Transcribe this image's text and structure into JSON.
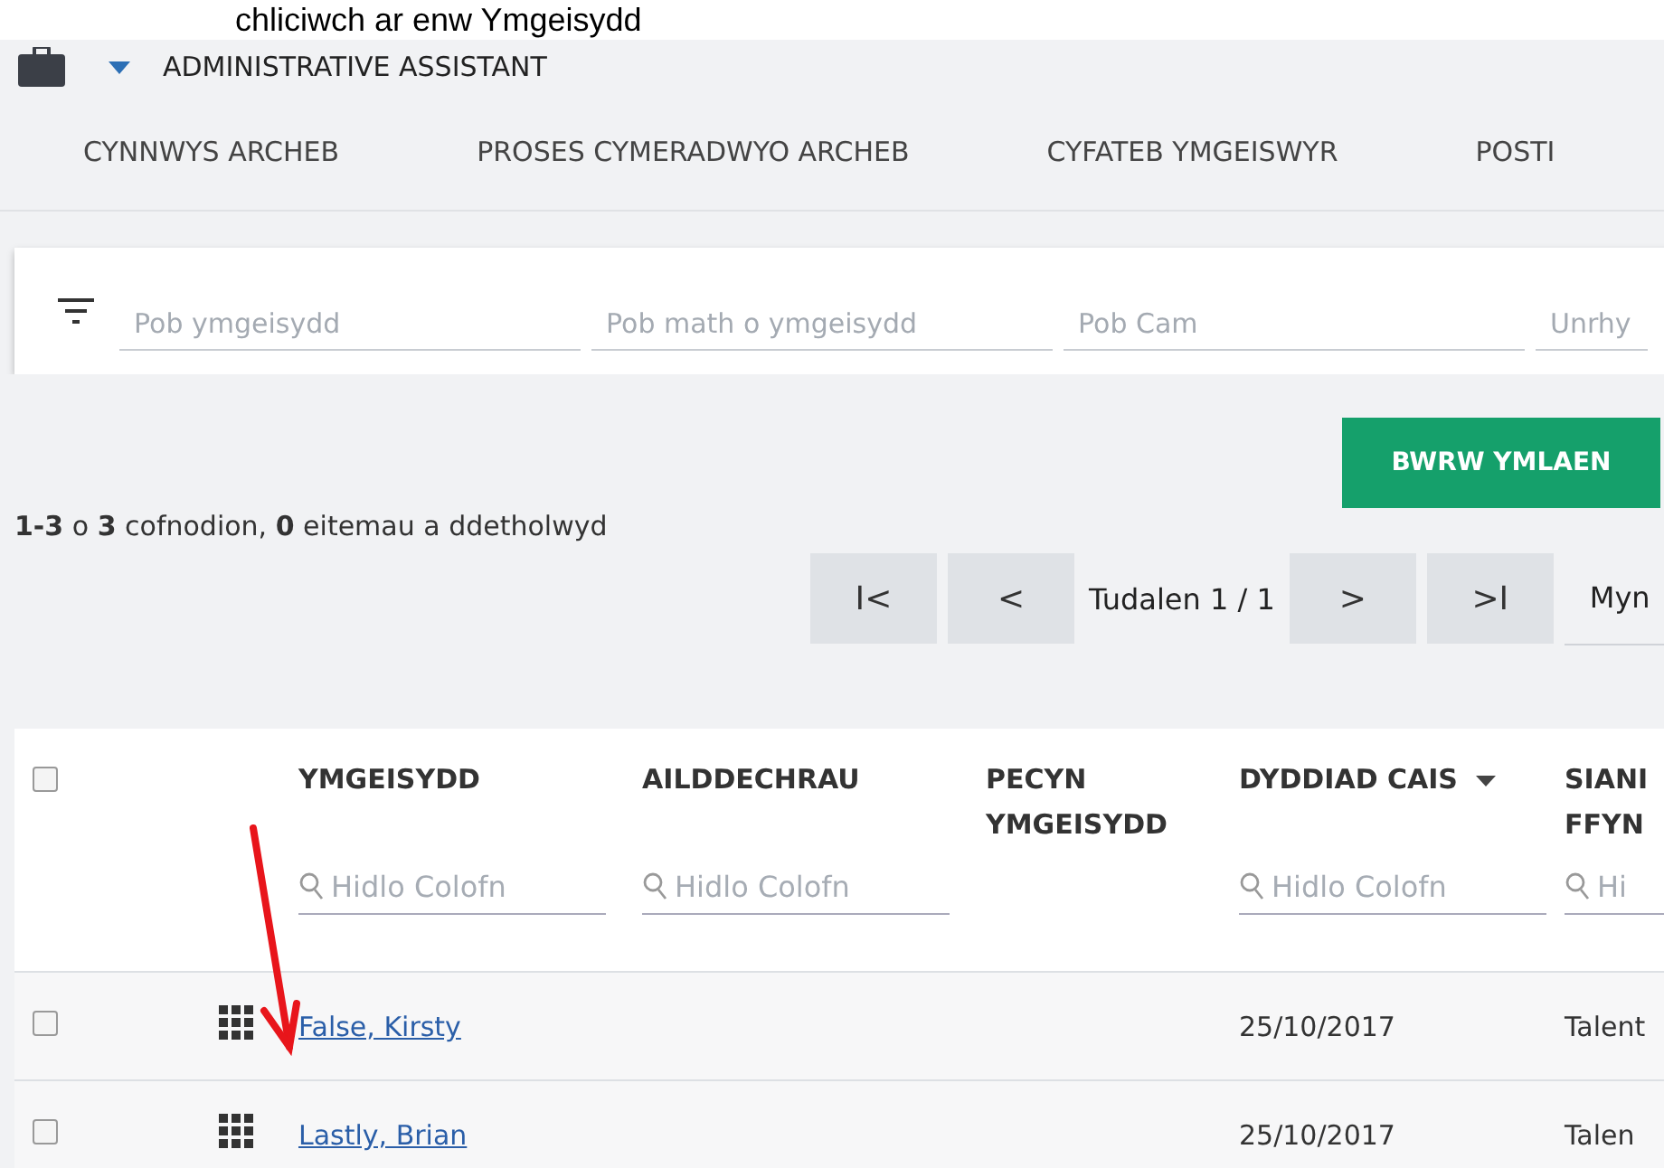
{
  "caption": "chliciwch ar enw Ymgeisydd",
  "header": {
    "title": "ADMINISTRATIVE ASSISTANT"
  },
  "tabs": [
    {
      "label": "CYNNWYS ARCHEB",
      "selected": false
    },
    {
      "label": "PROSES CYMERADWYO ARCHEB",
      "selected": false
    },
    {
      "label": "CYFATEB YMGEISWYR",
      "selected": false
    },
    {
      "label": "POSTI",
      "selected": false
    }
  ],
  "filters": [
    {
      "placeholder": "Pob ymgeisydd"
    },
    {
      "placeholder": "Pob math o ymgeisydd"
    },
    {
      "placeholder": "Pob Cam"
    },
    {
      "placeholder": "Unrhy"
    }
  ],
  "proceed_button": "BWRW YMLAEN",
  "summary": "**1-3** o **3** cofnodion, **0** eitemau a ddetholwyd",
  "pagination": {
    "first": "I<",
    "prev": "<",
    "page": "Tudalen 1 / 1",
    "next": ">",
    "last": ">I",
    "goto": "Myn"
  },
  "table": {
    "select_all_checked": false,
    "columns": [
      {
        "label": "YMGEISYDD",
        "filter": "Hidlo Colofn"
      },
      {
        "label": "AILDDECHRAU",
        "filter": "Hidlo Colofn"
      },
      {
        "label": "PECYN YMGEISYDD"
      },
      {
        "label": "DYDDIAD CAIS",
        "filter": "Hidlo Colofn",
        "sorted": true
      },
      {
        "label": "SIANI FFYN",
        "filter": "Hi"
      }
    ],
    "rows": [
      {
        "checked": false,
        "cells": [
          "False, Kirsty",
          "",
          "",
          "25/10/2017",
          "Talent"
        ]
      },
      {
        "checked": false,
        "cells": [
          "Lastly, Brian",
          "",
          "",
          "25/10/2017",
          "Talen"
        ]
      }
    ]
  }
}
